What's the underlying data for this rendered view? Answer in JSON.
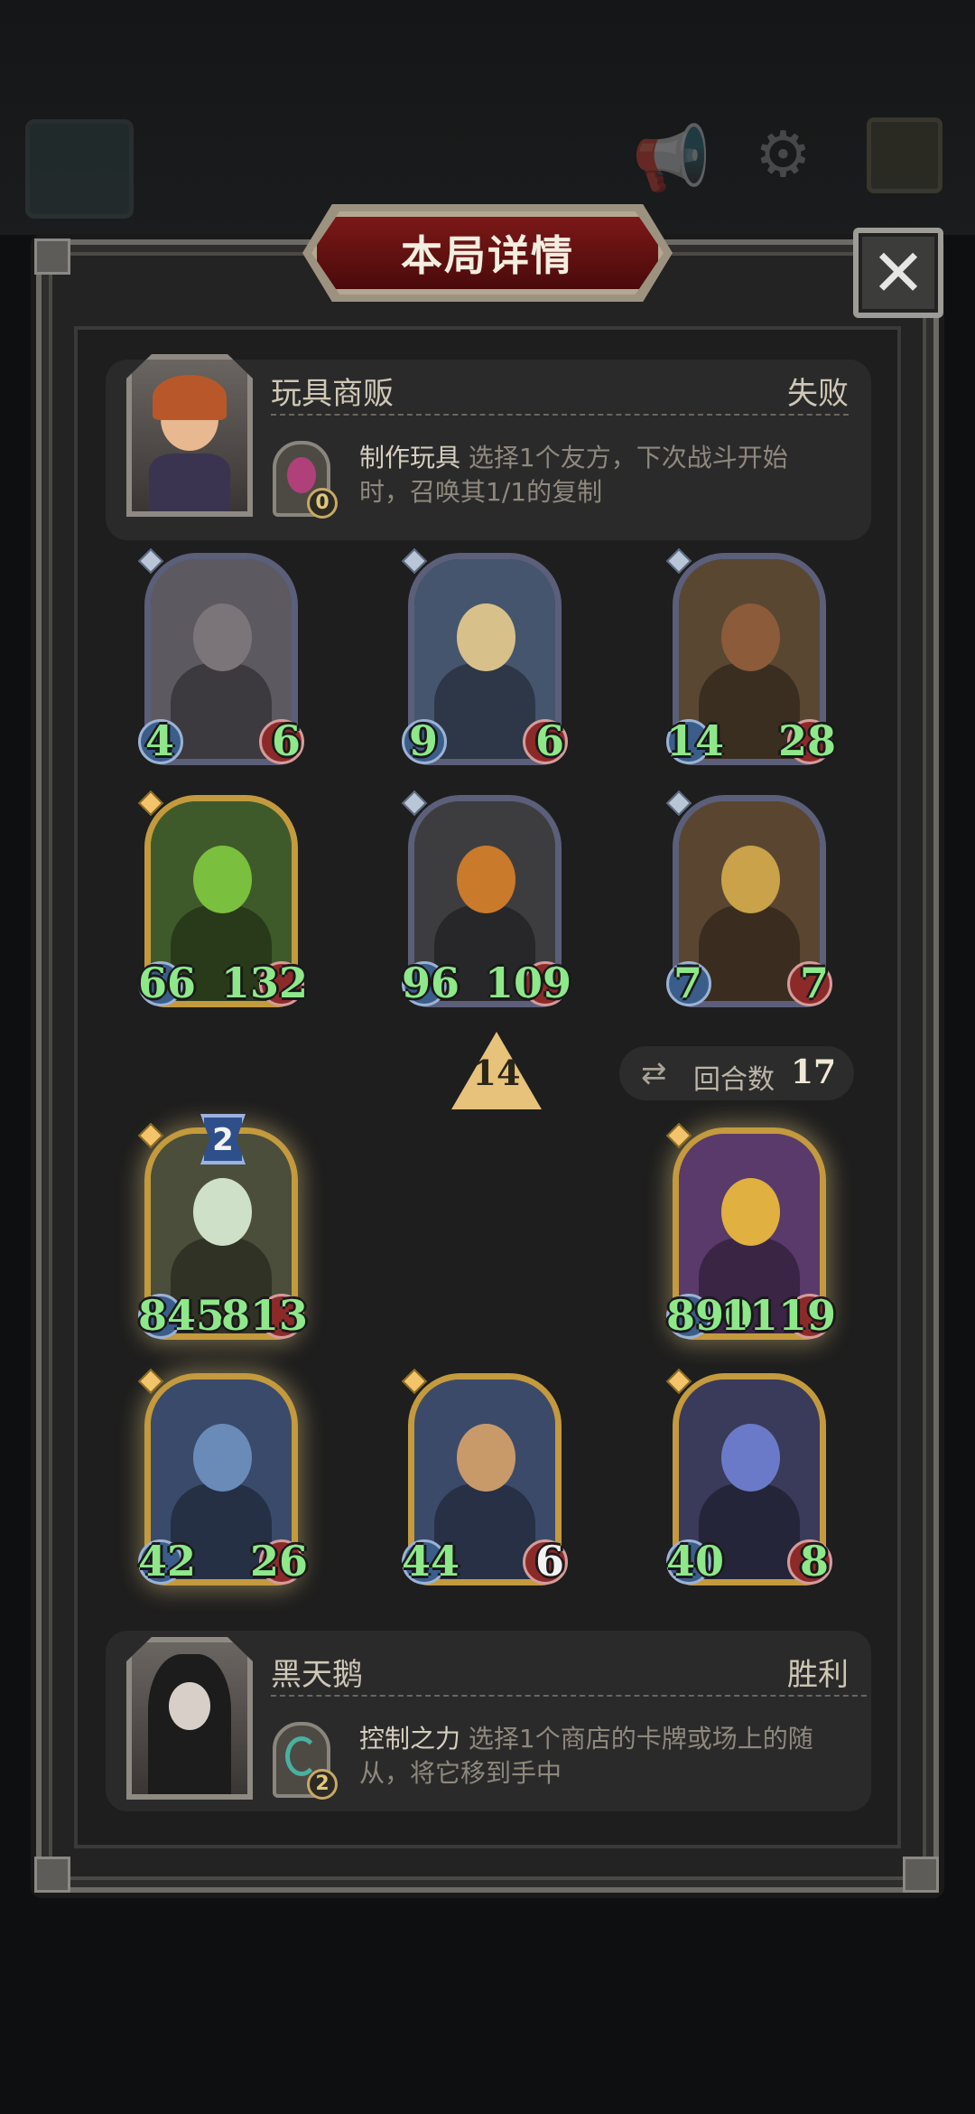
{
  "title": "本局详情",
  "close_symbol": "✕",
  "top_player": {
    "name": "玩具商贩",
    "result": "失败",
    "skill_name": "制作玩具",
    "skill_desc_1": "选择1个友方，下次战斗开始",
    "skill_desc_2": "时，召唤其1/1的复制",
    "skill_count": "0"
  },
  "bottom_player": {
    "name": "黑天鹅",
    "result": "胜利",
    "skill_name": "控制之力",
    "skill_desc_1": "选择1个商店的卡牌或场上的随",
    "skill_desc_2": "从，将它移到手中",
    "skill_count": "2"
  },
  "tier": "14",
  "rounds": {
    "label": "回合数",
    "value": "17"
  },
  "level_badge": "2",
  "top_cards": [
    {
      "atk": "4",
      "hp": "6",
      "frame": "silver",
      "art": "#5c5a60",
      "head": "#7b7478"
    },
    {
      "atk": "9",
      "hp": "6",
      "frame": "silver",
      "art": "#45556e",
      "head": "#d8c08a"
    },
    {
      "atk": "14",
      "hp": "28",
      "frame": "silver",
      "art": "#5a4732",
      "head": "#8c5b3a"
    },
    {
      "atk": "66",
      "hp": "132",
      "frame": "gold",
      "art": "#3f5a2a",
      "head": "#7bbf3e"
    },
    {
      "atk": "96",
      "hp": "109",
      "frame": "silver",
      "art": "#3d3d40",
      "head": "#c97a2a"
    },
    {
      "atk": "7",
      "hp": "7",
      "frame": "silver",
      "art": "#5a4630",
      "head": "#c9a24a"
    }
  ],
  "bottom_cards": [
    {
      "atk": "845",
      "hp": "813",
      "frame": "gold",
      "art": "#4a4e3a",
      "head": "#cfe0c8"
    },
    {
      "atk": "890",
      "hp": "1119",
      "frame": "gold",
      "art": "#5a3a6a",
      "head": "#e0b040"
    },
    {
      "atk": "42",
      "hp": "26",
      "frame": "gold",
      "art": "#3a4a6a",
      "head": "#6a8ab8"
    },
    {
      "atk": "44",
      "hp": "6",
      "frame": "gold",
      "art": "#3c4a6a",
      "head": "#c89a6a"
    },
    {
      "atk": "40",
      "hp": "8",
      "frame": "gold",
      "art": "#3a3a5a",
      "head": "#6a7ac8"
    }
  ]
}
